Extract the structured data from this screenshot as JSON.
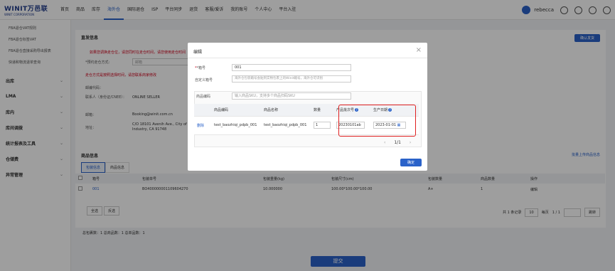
{
  "header": {
    "logo_main": "WINIT万邑联",
    "logo_sub": "WINIT CORPORATION",
    "nav": [
      "首页",
      "商品",
      "库存",
      "海外仓",
      "国际退仓",
      "ISP",
      "平台同步",
      "退货",
      "客服/爱诉",
      "我的账号",
      "个人中心",
      "平台入驻"
    ],
    "active_nav": "海外仓",
    "user": "rebecca"
  },
  "sidebar": {
    "sub_items": [
      "FBA退仓VAT规则",
      "FBA退仓标签VAT",
      "FBA退仓直接采购导出报表",
      "快递和物流退单查询"
    ],
    "items": [
      {
        "label": "出库"
      },
      {
        "label": "LMA"
      },
      {
        "label": "库内"
      },
      {
        "label": "库间调拨"
      },
      {
        "label": "统计报表及工具"
      },
      {
        "label": "仓储费"
      },
      {
        "label": "异常管理"
      }
    ]
  },
  "page": {
    "section_title": "直发信息",
    "confirm_send": "确认发货",
    "warning1": "如果您调换走仓位，请您同时在走仓时间，请您使用走仓时间",
    "field_label_address_type": "*预约走仓方式:",
    "field_value_address_type": "邮箱",
    "warning2": "走仓方式是按照选择时间，请您联系商家修改",
    "label_contact_name": "联系人（身份证/CNEE）：",
    "value_contact_name": "ONLINE SELLER",
    "label_email": "邮箱：",
    "value_email": "Booking@winit.com.cn",
    "label_address": "地址：",
    "value_address": "C/O 18101 Avenih Ave., City of Industry, CA 91748",
    "label_postcode": "邮编代码：",
    "goods_title": "商品信息",
    "batch_upload": "批量上传商品信息",
    "tabs": [
      "包装信息",
      "商品信息"
    ],
    "goods_cols": [
      "",
      "箱号",
      "包装单号",
      "包装重量(kg)",
      "包装尺寸(cm)",
      "包装数量",
      "商品数量",
      "操作"
    ],
    "goods_row": [
      "",
      "001",
      "BO400000001109604270",
      "10.000000",
      "100.00*100.00*100.00",
      "A+",
      "1",
      "编辑"
    ],
    "btn_select_all": "全选",
    "btn_invert": "反选",
    "pager_total": "共 1 条记录",
    "pager_size": "10",
    "pager_unit": "每页",
    "pager_pages": "1 / 1",
    "pager_go": "跳转",
    "summary": "总包裹数：1 总商品数：1 总单品数：1",
    "submit": "提交"
  },
  "dialog": {
    "title": "编辑",
    "label_box_no": "*箱号",
    "value_box_no": "001",
    "label_custom_no": "自定义箱号",
    "placeholder_custom_no": "海外仓包装箱号会贴到实物包裹上的Winit箱号，海外仓可识别",
    "label_sku": "商品编码",
    "placeholder_sku": "输入商品SKU，支持多个商品扫码SKU",
    "table_cols": [
      "",
      "商品编码",
      "商品名称",
      "数量",
      "产品批次号",
      "生产日期"
    ],
    "row": {
      "action": "删除",
      "code": "test_baozhiqi_pdpb_001",
      "name": "test_baozhiqi_pdpb_001",
      "qty": "1",
      "batch": "20230101ab",
      "date": "2023-01-01"
    },
    "pager": "1/1",
    "confirm": "确定"
  },
  "colors": {
    "primary": "#2a62c9",
    "highlight": "#e02020",
    "warning": "#d0021b"
  }
}
